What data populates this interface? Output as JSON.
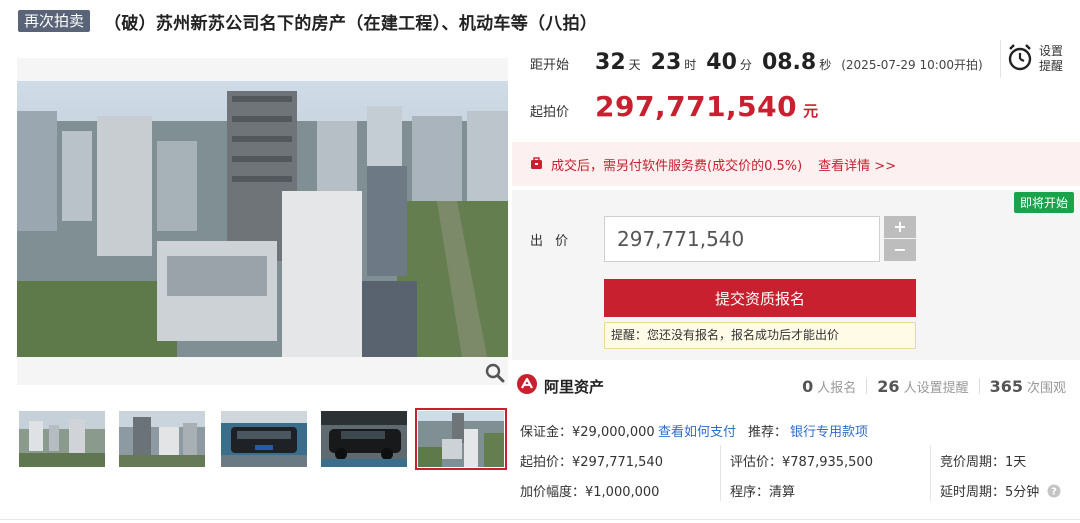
{
  "header": {
    "tag": "再次拍卖",
    "title": "（破）苏州新苏公司名下的房产（在建工程）、机动车等（八拍）"
  },
  "gallery": {
    "thumb_count": 5,
    "active_index": 4
  },
  "countdown": {
    "label": "距开始",
    "days": "32",
    "days_unit": "天",
    "hours": "23",
    "hours_unit": "时",
    "minutes": "40",
    "minutes_unit": "分",
    "seconds": "08.8",
    "seconds_unit": "秒",
    "start_time": "(2025-07-29 10:00开拍)"
  },
  "reminder": {
    "line1": "设置",
    "line2": "提醒"
  },
  "start_price": {
    "label": "起拍价",
    "value": "297,771,540",
    "unit": "元"
  },
  "notice": {
    "text": "成交后，需另付软件服务费(成交价的0.5%)",
    "link": "查看详情 >>"
  },
  "bid": {
    "badge": "即将开始",
    "label": "出 价",
    "input_value": "297,771,540",
    "plus": "+",
    "minus": "−",
    "submit_label": "提交资质报名",
    "hint": "提醒：您还没有报名，报名成功后才能出价"
  },
  "brand": {
    "name": "阿里资产"
  },
  "stats": {
    "signup_count": "0",
    "signup_label": "人报名",
    "reminder_count": "26",
    "reminder_label": "人设置提醒",
    "view_count": "365",
    "view_label": "次围观"
  },
  "details": {
    "deposit": "保证金：¥29,000,000",
    "how_to_pay": "查看如何支付",
    "recommend_label": "推荐：",
    "recommend_link": "银行专用款项",
    "start_price": "起拍价：¥297,771,540",
    "appraisal": "评估价：¥787,935,500",
    "cycle": "竞价周期：1天",
    "increment": "加价幅度：¥1,000,000",
    "procedure": "程序：清算",
    "delay": "延时周期：5分钟"
  },
  "colors": {
    "accent_red": "#c8202e",
    "link_blue": "#2d6dcc",
    "badge_green": "#1aa34a",
    "tag_gray": "#5a6478"
  }
}
